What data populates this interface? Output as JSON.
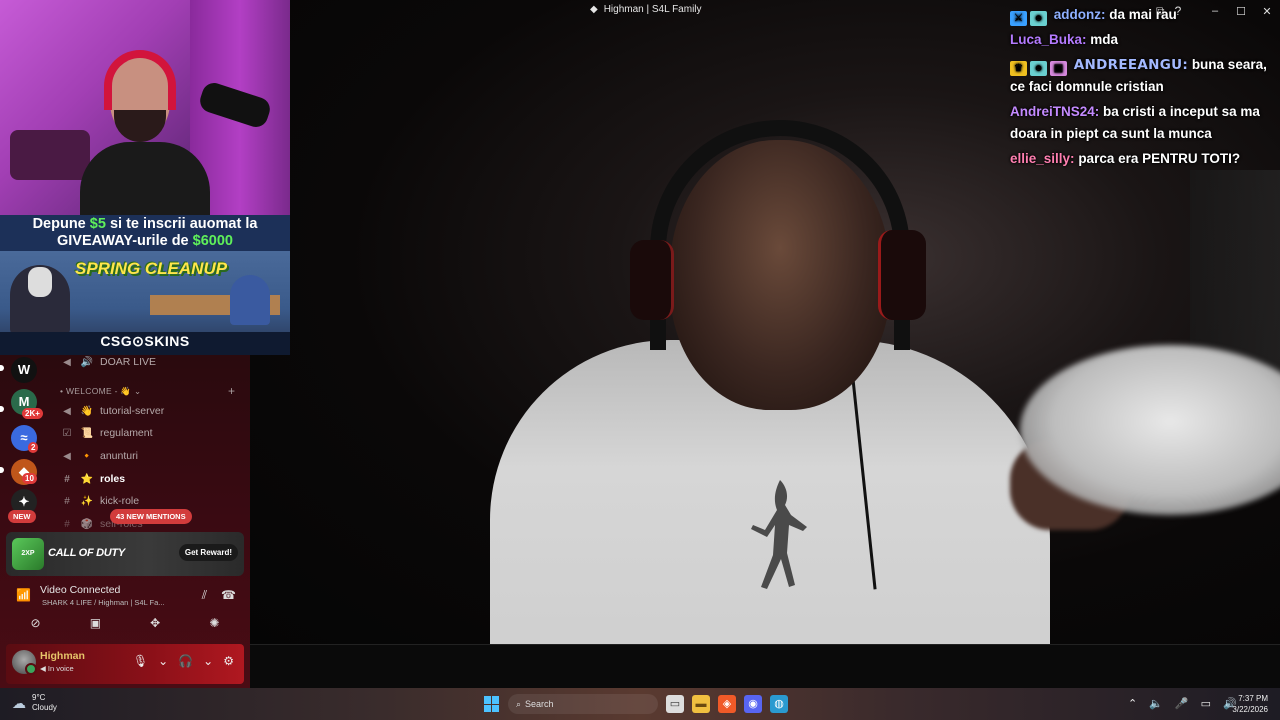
{
  "window": {
    "title": "Highman | S4L Family",
    "controls": [
      "minimize",
      "maximize",
      "close"
    ]
  },
  "chat": {
    "messages": [
      {
        "user": "addonz:",
        "text": "da mai rau",
        "badges": [
          "moderator-sword",
          "robot"
        ]
      },
      {
        "user": "Luca_Buka:",
        "text": "mda",
        "badges": []
      },
      {
        "user": "ANDREEANGU:",
        "text": "buna seara, ce faci domnule cristian",
        "badges": [
          "crown",
          "robot",
          "gift"
        ]
      },
      {
        "user": "AndreiTNS24:",
        "text": "ba cristi a inceput sa ma doara in piept ca sunt la munca",
        "badges": []
      },
      {
        "user": "ellie_silly:",
        "text": "parca era PENTRU TOTI?",
        "badges": []
      }
    ]
  },
  "giveaway": {
    "line1_pre": "Depune ",
    "line1_amount": "$5",
    "line1_post": " si te inscrii auomat la",
    "line2_pre": "GIVEAWAY-urile de ",
    "line2_amount": "$6000",
    "art_title": "SPRING CLEANUP",
    "brand": "CSG⊙SKINS"
  },
  "discord": {
    "servers": [
      {
        "label": "W",
        "color": "#111111",
        "badge": ""
      },
      {
        "label": "M",
        "color": "#2a6a4a",
        "badge": "2K+"
      },
      {
        "label": "≈",
        "color": "#3a6ae0",
        "badge": "2"
      },
      {
        "label": "◆",
        "color": "#c0561a",
        "badge": "10"
      },
      {
        "label": "✦",
        "color": "#222222",
        "badge": ""
      }
    ],
    "new_pill": "NEW",
    "top_channel": "DOAR LIVE",
    "category": "WELCOME - 👋",
    "channels": [
      {
        "name": "tutorial-server",
        "icon": "megaphone-icon",
        "emoji": "👋",
        "active": false
      },
      {
        "name": "regulament",
        "icon": "rules-icon",
        "emoji": "📜",
        "active": false
      },
      {
        "name": "anunturi",
        "icon": "megaphone-icon",
        "emoji": "📢",
        "active": false
      },
      {
        "name": "roles",
        "icon": "hash-icon",
        "emoji": "⭐",
        "active": true
      },
      {
        "name": "kick-role",
        "icon": "hash-icon",
        "emoji": "✨",
        "active": false
      },
      {
        "name": "self-roles",
        "icon": "hash-icon",
        "emoji": "🎲",
        "active": false
      }
    ],
    "mentions": "43 NEW MENTIONS",
    "promo": {
      "badge": "2XP",
      "title": "CALL OF DUTY",
      "button": "Get Reward!"
    },
    "voice": {
      "status": "Video Connected",
      "location": "SHARK 4 LIFE / Highman | S4L Fa..."
    },
    "user": {
      "name": "Highman",
      "status": "In voice"
    }
  },
  "taskbar": {
    "weather_temp": "9°C",
    "weather_desc": "Cloudy",
    "search": "Search",
    "time": "7:37 PM",
    "date": "3/22/2026"
  }
}
